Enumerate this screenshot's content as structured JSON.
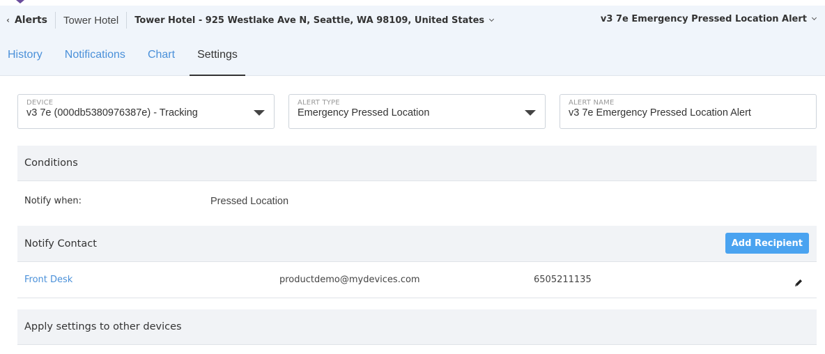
{
  "breadcrumb": {
    "back_label": "Alerts",
    "hotel": "Tower Hotel",
    "location": "Tower Hotel - 925 Westlake Ave N, Seattle, WA 98109, United States"
  },
  "alert_selector": {
    "value": "v3 7e Emergency Pressed Location Alert"
  },
  "tabs": [
    {
      "label": "History"
    },
    {
      "label": "Notifications"
    },
    {
      "label": "Chart"
    },
    {
      "label": "Settings",
      "active": true
    }
  ],
  "fields": {
    "device": {
      "label": "DEVICE",
      "value": "v3 7e (000db5380976387e) - Tracking"
    },
    "alert_type": {
      "label": "ALERT TYPE",
      "value": "Emergency Pressed Location"
    },
    "alert_name": {
      "label": "ALERT NAME",
      "value": "v3 7e Emergency Pressed Location Alert"
    }
  },
  "conditions": {
    "title": "Conditions",
    "notify_when_label": "Notify when:",
    "notify_when_value": "Pressed Location"
  },
  "notify_contact": {
    "title": "Notify Contact",
    "add_button": "Add Recipient",
    "contacts": [
      {
        "name": "Front Desk",
        "email": "productdemo@mydevices.com",
        "phone": "6505211135"
      }
    ]
  },
  "apply_settings": {
    "title": "Apply settings to other devices"
  },
  "icons": {
    "back": "chevron-left-icon",
    "dropdown": "chevron-down-icon",
    "edit": "pencil-icon"
  },
  "colors": {
    "link": "#4a90d9",
    "button": "#4aa3f0",
    "header_bg": "#f0f5fb",
    "section_bg": "#f1f3f6"
  }
}
